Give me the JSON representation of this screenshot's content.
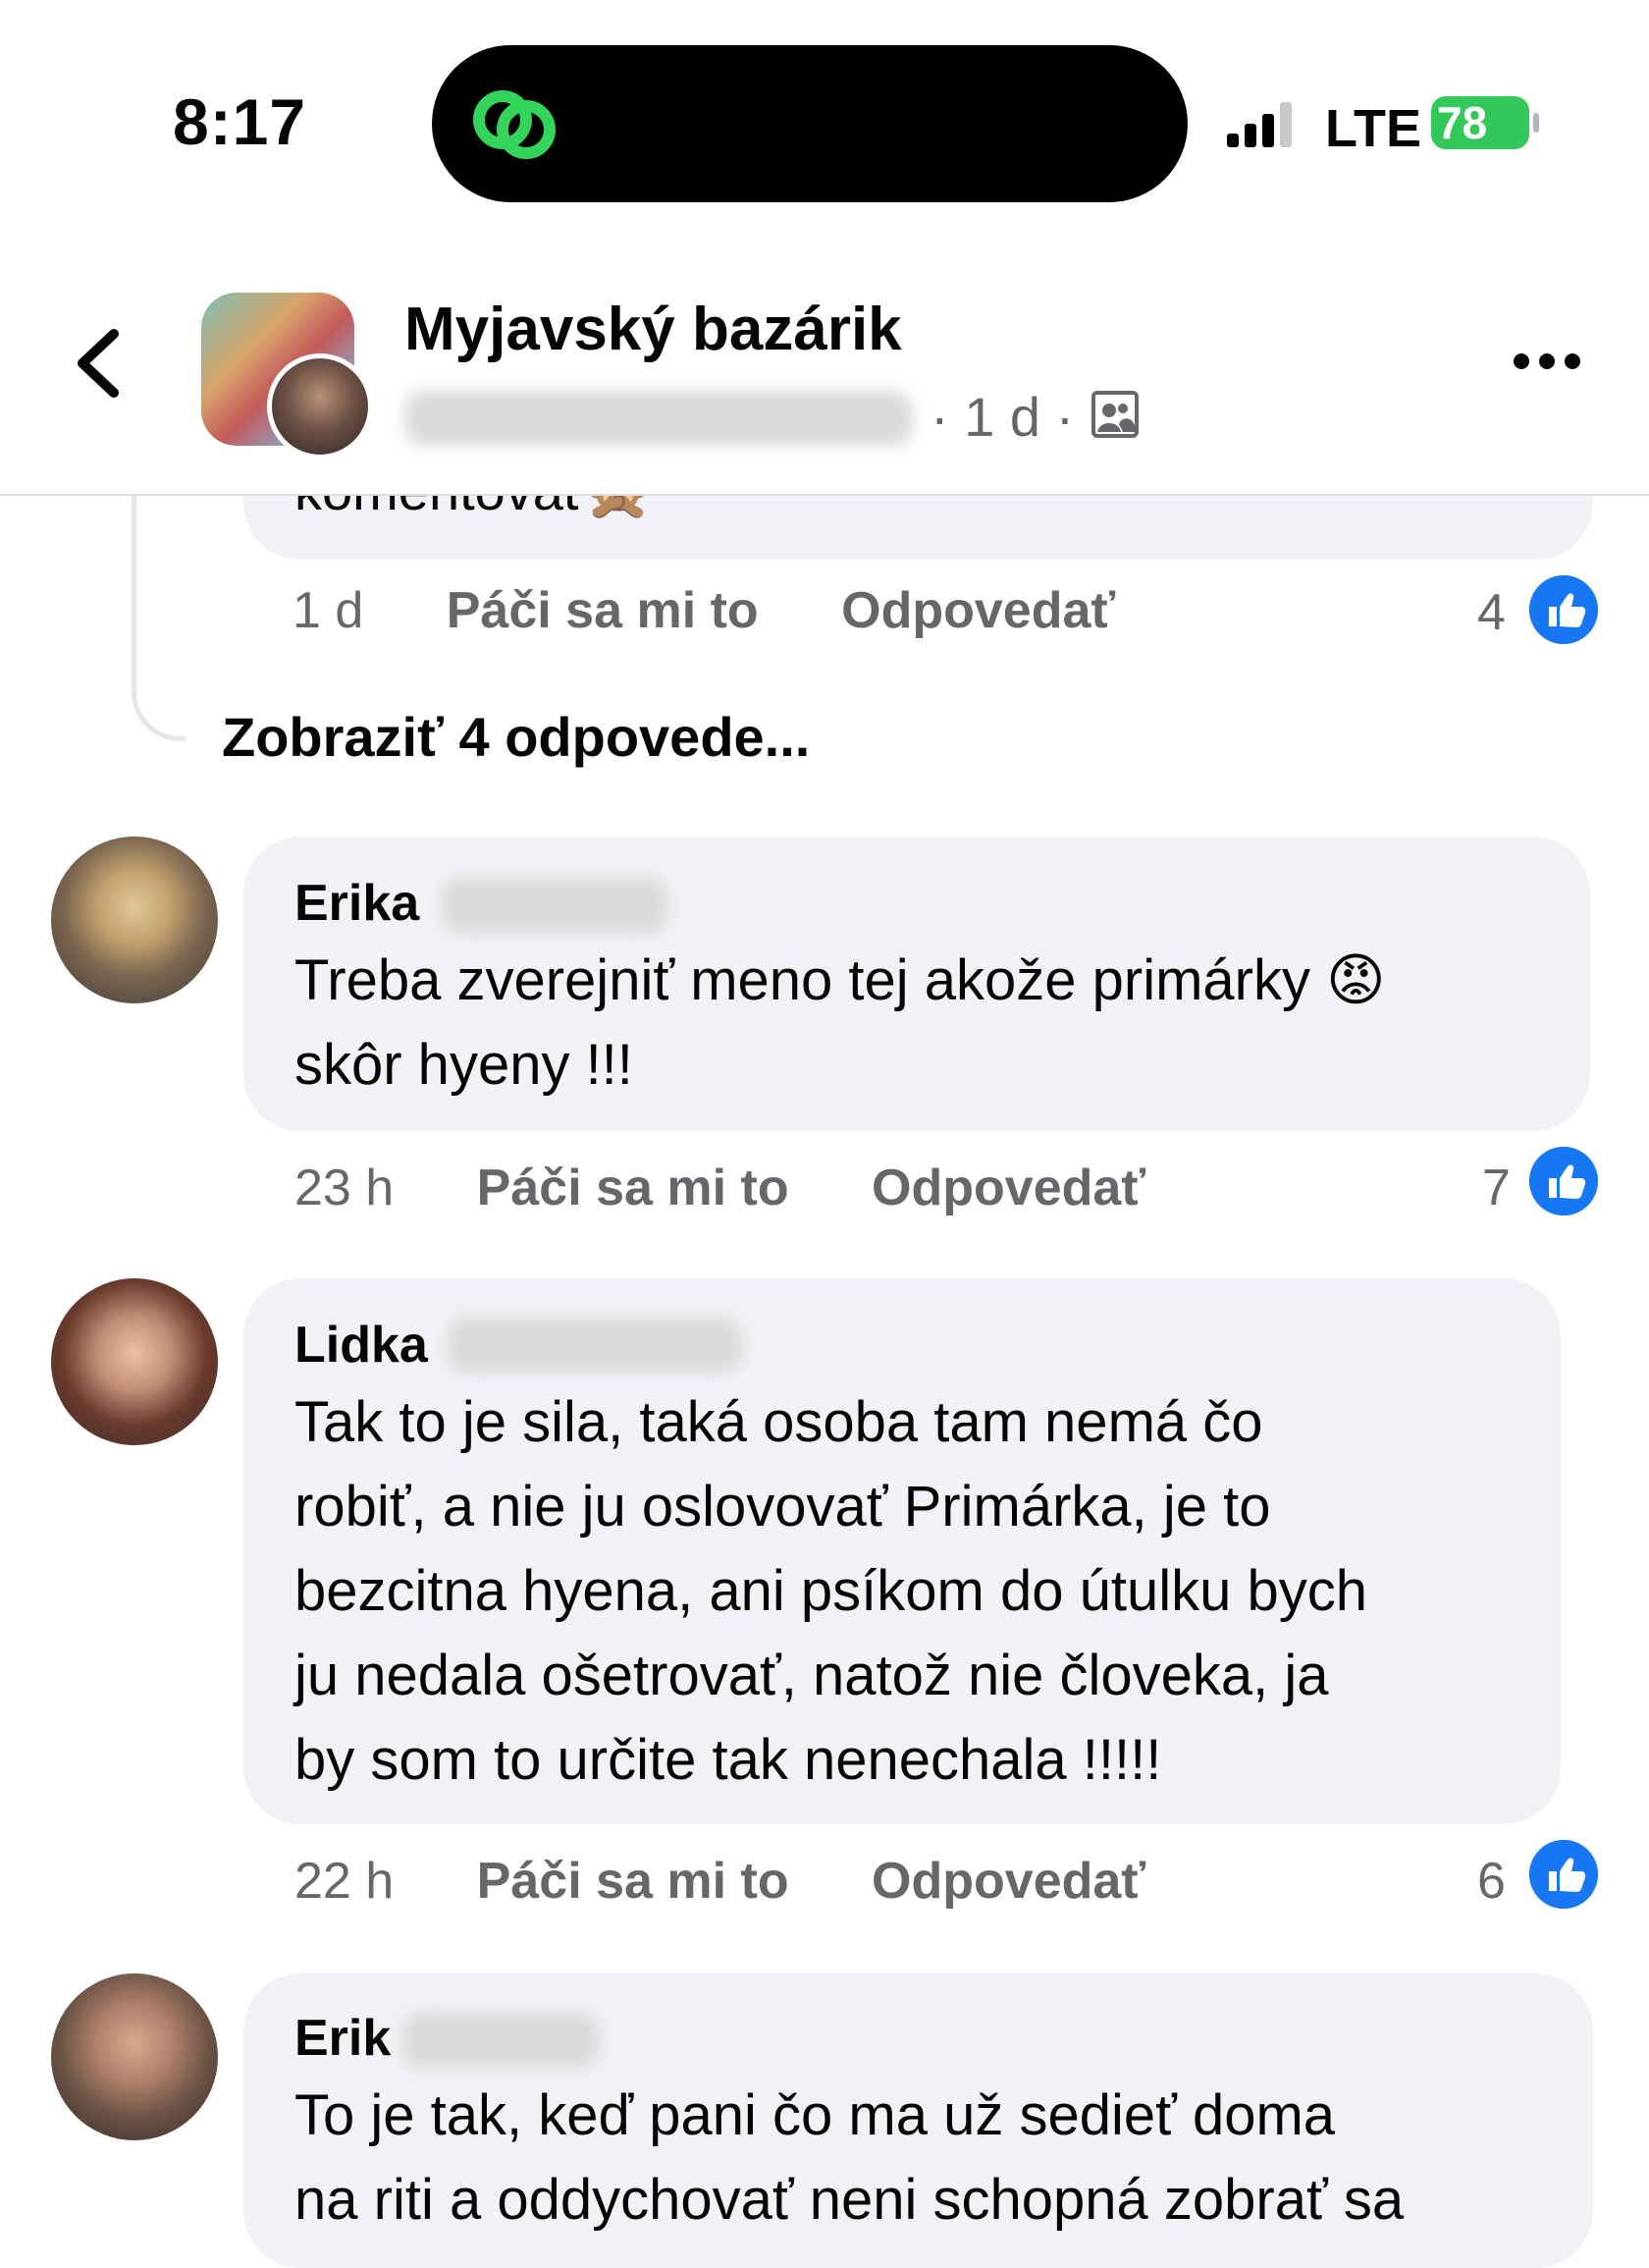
{
  "status_bar": {
    "time": "8:17",
    "network": "LTE",
    "battery": "78"
  },
  "header": {
    "group_name": "Myjavský bazárik",
    "meta": "· 1 d ·"
  },
  "top_comment": {
    "cut_text": "komentovať🙊",
    "time": "1 d",
    "like_label": "Páči sa mi to",
    "reply_label": "Odpovedať",
    "likes": "4"
  },
  "view_replies": "Zobraziť 4 odpovede...",
  "comments": [
    {
      "name": "Erika",
      "text_lines": [
        "Treba zverejniť meno tej akože primárky 😡",
        "skôr hyeny !!!"
      ],
      "time": "23 h",
      "like_label": "Páči sa mi to",
      "reply_label": "Odpovedať",
      "likes": "7"
    },
    {
      "name": "Lidka",
      "text_lines": [
        "Tak to je sila,  taká osoba tam nemá čo",
        "robiť,  a nie ju oslovovať Primárka,  je to",
        "bezcitna hyena, ani psíkom do útulku bych",
        "ju nedala ošetrovať,  natož nie človeka,  ja",
        "by som to určite tak nenechala  !!!!!"
      ],
      "time": "22 h",
      "like_label": "Páči sa mi to",
      "reply_label": "Odpovedať",
      "likes": "6"
    },
    {
      "name": "Erik",
      "text_lines": [
        "To je tak, keď pani čo ma už sedieť doma",
        "na riti a oddychovať neni schopná zobrať sa"
      ]
    }
  ],
  "icons": {
    "back": "chevron-left-icon",
    "more": "more-horizontal-icon",
    "privacy": "group-members-icon",
    "like": "thumbs-up-icon",
    "island": "link-rings-icon"
  },
  "colors": {
    "accent": "#1877f2",
    "bubble": "#f0f2f5",
    "muted": "#65676b",
    "battery": "#34c759"
  }
}
